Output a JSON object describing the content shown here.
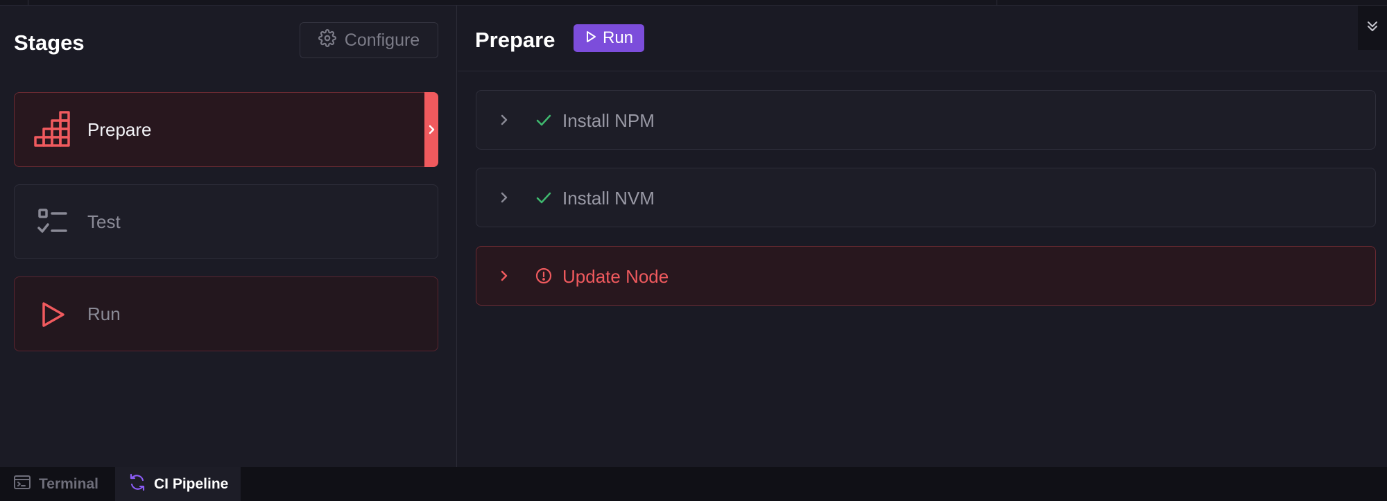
{
  "sidebar": {
    "title": "Stages",
    "configure_label": "Configure",
    "stages": [
      {
        "label": "Prepare",
        "icon": "stairs-icon",
        "state": "active"
      },
      {
        "label": "Test",
        "icon": "checklist-icon",
        "state": "idle"
      },
      {
        "label": "Run",
        "icon": "play-icon",
        "state": "failed"
      }
    ]
  },
  "main": {
    "title": "Prepare",
    "run_label": "Run",
    "steps": [
      {
        "label": "Install NPM",
        "status": "success",
        "icon": "check-icon"
      },
      {
        "label": "Install NVM",
        "status": "success",
        "icon": "check-icon"
      },
      {
        "label": "Update Node",
        "status": "error",
        "icon": "alert-circle-icon"
      }
    ]
  },
  "bottom_tabs": [
    {
      "label": "Terminal",
      "icon": "terminal-icon",
      "active": false
    },
    {
      "label": "CI Pipeline",
      "icon": "refresh-icon",
      "active": true
    }
  ],
  "colors": {
    "accent": "#7c4ddb",
    "danger": "#f05a5e",
    "success": "#3fb96f",
    "background": "#1a1a24"
  }
}
